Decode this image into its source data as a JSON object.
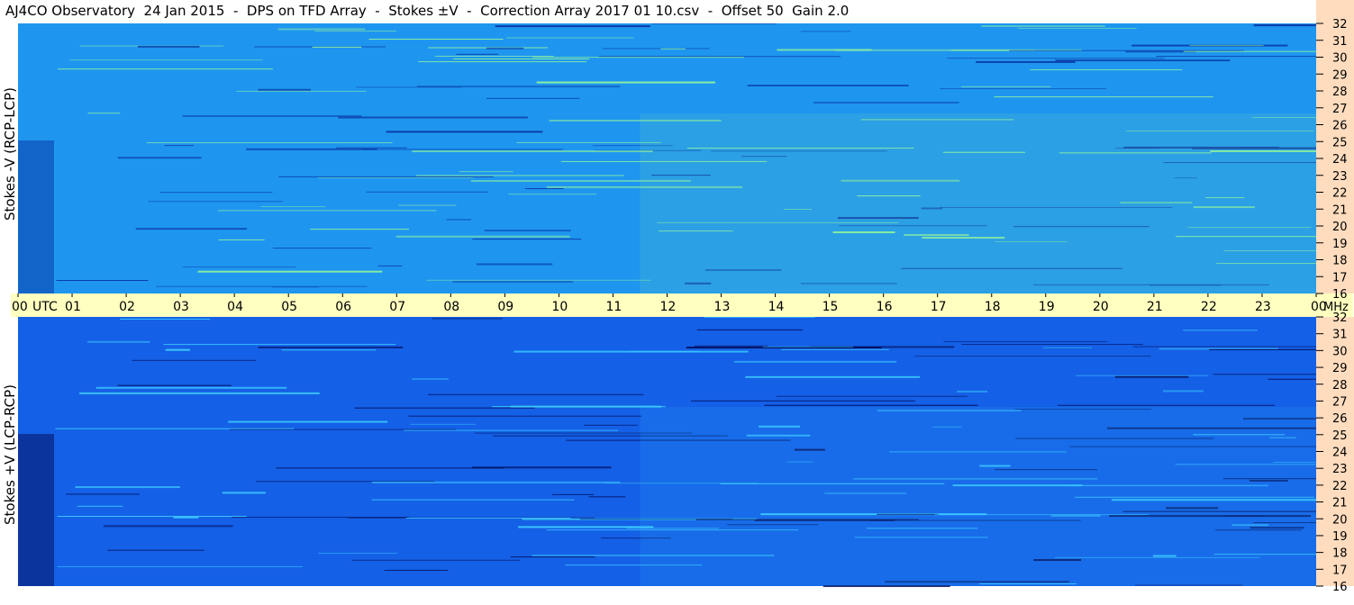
{
  "title": "AJ4CO Observatory  24 Jan 2015  -  DPS on TFD Array  -  Stokes ±V  -  Correction Array 2017 01 10.csv  -  Offset 50  Gain 2.0",
  "colors": {
    "strip": "#ffffc0",
    "right_axis": "#ffdcbe",
    "top_panel": "#1e96f0",
    "bottom_panel": "#1460e6"
  },
  "chart_data": {
    "type": "heatmap",
    "title": "AJ4CO Observatory  24 Jan 2015  -  DPS on TFD Array  -  Stokes ±V  -  Correction Array 2017 01 10.csv  -  Offset 50  Gain 2.0",
    "x_axis": {
      "unit_label": "UTC",
      "range_hours": [
        0,
        24
      ],
      "tick_labels": [
        "00",
        "01",
        "02",
        "03",
        "04",
        "05",
        "06",
        "07",
        "08",
        "09",
        "10",
        "11",
        "12",
        "13",
        "14",
        "15",
        "16",
        "17",
        "18",
        "19",
        "20",
        "21",
        "22",
        "23",
        "00"
      ]
    },
    "y_axis": {
      "unit_label": "MHz",
      "range": [
        16,
        32
      ],
      "ticks": [
        32,
        31,
        30,
        29,
        28,
        27,
        26,
        25,
        24,
        23,
        22,
        21,
        20,
        19,
        18,
        17,
        16
      ]
    },
    "panels": [
      {
        "name": "Stokes -V (RCP-LCP)",
        "ylabel": "Stokes -V (RCP-LCP)"
      },
      {
        "name": "Stokes +V (LCP-RCP)",
        "ylabel": "Stokes +V (LCP-RCP)"
      }
    ]
  }
}
